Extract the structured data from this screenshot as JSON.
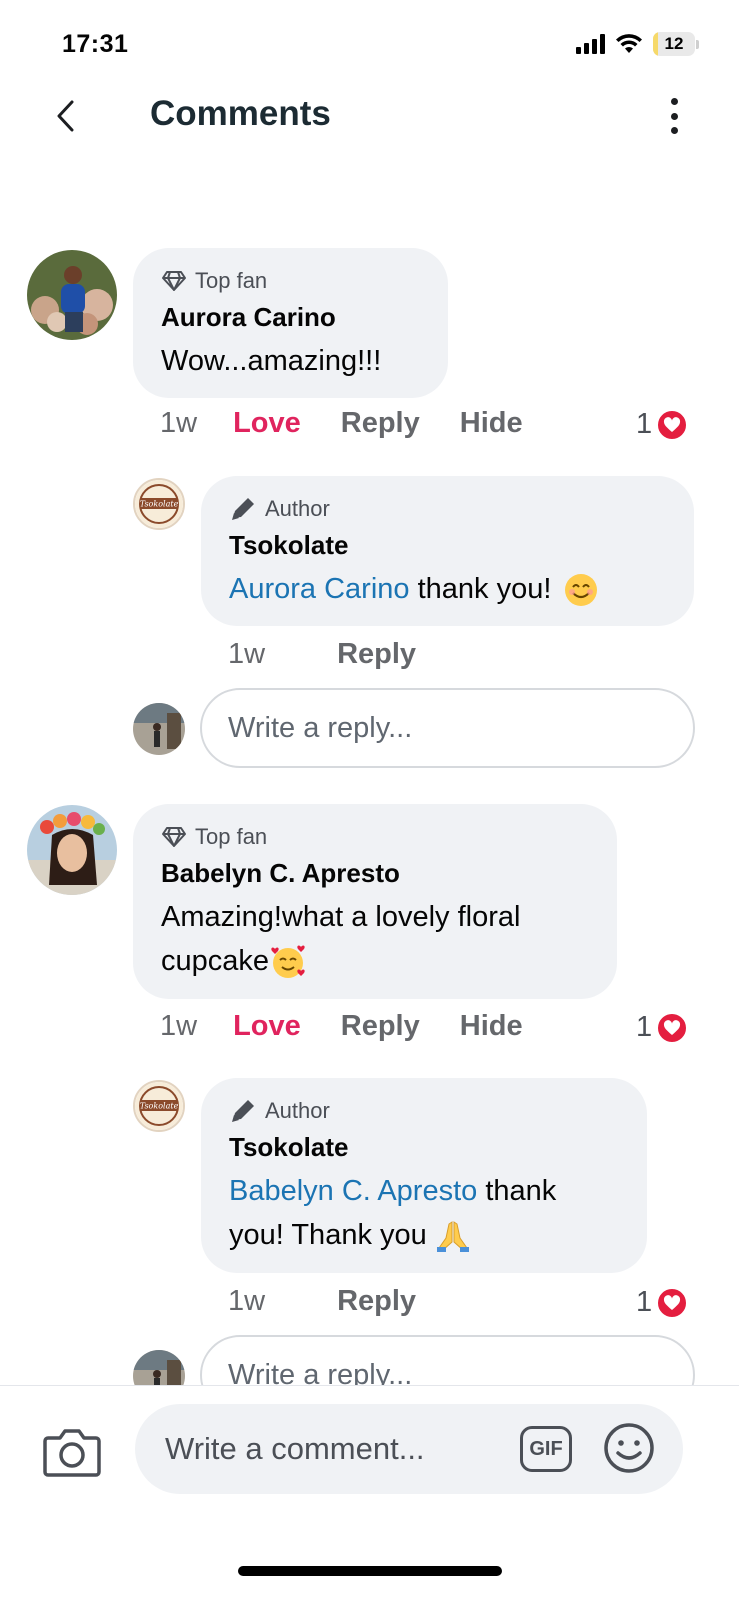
{
  "status_bar": {
    "time": "17:31",
    "battery": "12"
  },
  "header": {
    "title": "Comments"
  },
  "comments": [
    {
      "badge": "Top fan",
      "author": "Aurora Carino",
      "text": "Wow...amazing!!!",
      "time": "1w",
      "love_label": "Love",
      "reply_label": "Reply",
      "hide_label": "Hide",
      "reaction_count": "1",
      "replies": [
        {
          "badge": "Author",
          "author": "Tsokolate",
          "mention": "Aurora Carino",
          "text": " thank you! ",
          "emoji": "smiling-face-emoji",
          "time": "1w",
          "reply_label": "Reply"
        }
      ],
      "reply_placeholder": "Write a reply..."
    },
    {
      "badge": "Top fan",
      "author": "Babelyn C. Apresto",
      "text_line1": "Amazing!what a lovely floral",
      "text_line2": "cupcake",
      "emoji": "smiling-face-with-hearts-emoji",
      "time": "1w",
      "love_label": "Love",
      "reply_label": "Reply",
      "hide_label": "Hide",
      "reaction_count": "1",
      "replies": [
        {
          "badge": "Author",
          "author": "Tsokolate",
          "mention": "Babelyn C. Apresto",
          "text_line1": " thank",
          "text_line2": "you! Thank you ",
          "emoji": "folded-hands-emoji",
          "time": "1w",
          "reply_label": "Reply",
          "reaction_count": "1"
        }
      ],
      "reply_placeholder": "Write a reply..."
    }
  ],
  "composer": {
    "placeholder": "Write a comment...",
    "gif_label": "GIF"
  },
  "colors": {
    "love": "#e0245e",
    "mention": "#1b74b3",
    "bubble": "#f0f2f5",
    "heart": "#e41e3f"
  }
}
